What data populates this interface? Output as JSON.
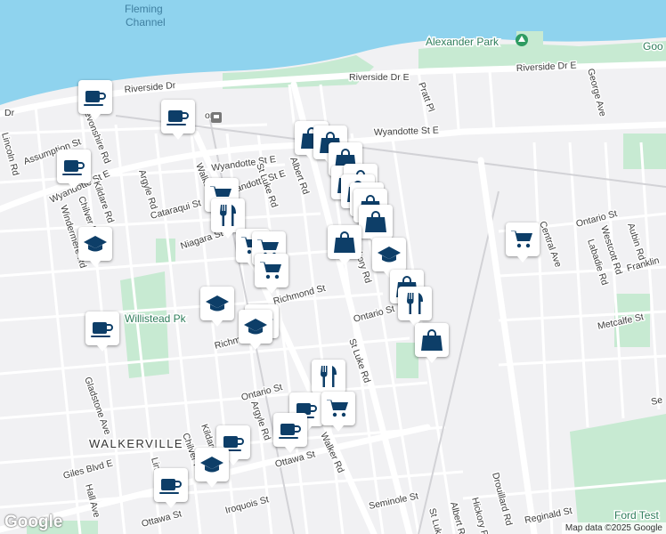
{
  "map": {
    "water_label": "Fleming\nChannel",
    "area_label": "WALKERVILLE",
    "attribution": "Map data ©2025 Google",
    "logo": "Google",
    "parks": [
      {
        "name": "Alexander Park"
      },
      {
        "name": "Willistead Pk"
      },
      {
        "name": "Ford Test"
      },
      {
        "name": "Goo"
      }
    ],
    "streets": [
      {
        "name": "Riverside Dr"
      },
      {
        "name": "Riverside Dr E"
      },
      {
        "name": "Riverside Dr E"
      },
      {
        "name": "Dr"
      },
      {
        "name": "Wyandotte St E"
      },
      {
        "name": "Wyandotte St E"
      },
      {
        "name": "Wyandotte St E"
      },
      {
        "name": "Assumption St"
      },
      {
        "name": "Devonshire Rd"
      },
      {
        "name": "Lincoln Rd"
      },
      {
        "name": "Kildare Rd"
      },
      {
        "name": "Chilver Rd"
      },
      {
        "name": "Windermere Rd"
      },
      {
        "name": "Argyle Rd"
      },
      {
        "name": "Cataraqui St"
      },
      {
        "name": "Walker Rd"
      },
      {
        "name": "Wyandotte St E"
      },
      {
        "name": "St Luke Rd"
      },
      {
        "name": "Albert Rd"
      },
      {
        "name": "Niagara St"
      },
      {
        "name": "Hickory Rd"
      },
      {
        "name": "Richmond St"
      },
      {
        "name": "Richmond St"
      },
      {
        "name": "Ontario St"
      },
      {
        "name": "St Luke Rd"
      },
      {
        "name": "Ontario St"
      },
      {
        "name": "Gladstone Ave"
      },
      {
        "name": "Argyle Rd"
      },
      {
        "name": "Chilver Rd"
      },
      {
        "name": "Kildare Rd"
      },
      {
        "name": "Ottawa St"
      },
      {
        "name": "Walker Rd"
      },
      {
        "name": "Giles Blvd E"
      },
      {
        "name": "Hall Ave"
      },
      {
        "name": "Lincoln Rd"
      },
      {
        "name": "Ottawa St"
      },
      {
        "name": "Iroquois St"
      },
      {
        "name": "Pratt Pl"
      },
      {
        "name": "George Ave"
      },
      {
        "name": "Central Ave"
      },
      {
        "name": "Ontario St"
      },
      {
        "name": "Westcott Rd"
      },
      {
        "name": "Aubin Rd"
      },
      {
        "name": "Labadie Rd"
      },
      {
        "name": "Franklin"
      },
      {
        "name": "Metcalfe St"
      },
      {
        "name": "Se"
      },
      {
        "name": "Seminole St"
      },
      {
        "name": "St Luke"
      },
      {
        "name": "Albert Rd"
      },
      {
        "name": "Hickory Rd"
      },
      {
        "name": "Drouillard Rd"
      },
      {
        "name": "Reginald St"
      },
      {
        "name": "or"
      }
    ],
    "markers": [
      {
        "icon": "cafe"
      },
      {
        "icon": "cafe"
      },
      {
        "icon": "cafe"
      },
      {
        "icon": "school"
      },
      {
        "icon": "cafe"
      },
      {
        "icon": "grocery"
      },
      {
        "icon": "restaurant"
      },
      {
        "icon": "grocery"
      },
      {
        "icon": "grocery"
      },
      {
        "icon": "grocery"
      },
      {
        "icon": "school"
      },
      {
        "icon": "school"
      },
      {
        "icon": "school"
      },
      {
        "icon": "shopping"
      },
      {
        "icon": "shopping"
      },
      {
        "icon": "shopping"
      },
      {
        "icon": "shopping"
      },
      {
        "icon": "shopping"
      },
      {
        "icon": "shopping"
      },
      {
        "icon": "shopping"
      },
      {
        "icon": "shopping"
      },
      {
        "icon": "shopping"
      },
      {
        "icon": "shopping"
      },
      {
        "icon": "school"
      },
      {
        "icon": "shopping"
      },
      {
        "icon": "restaurant"
      },
      {
        "icon": "shopping"
      },
      {
        "icon": "grocery"
      },
      {
        "icon": "restaurant"
      },
      {
        "icon": "cafe"
      },
      {
        "icon": "grocery"
      },
      {
        "icon": "cafe"
      },
      {
        "icon": "cafe"
      },
      {
        "icon": "school"
      },
      {
        "icon": "cafe"
      }
    ]
  },
  "colors": {
    "water": "#8fd3ee",
    "park": "#c7ead2",
    "road": "#ffffff",
    "land": "#f1f1f3",
    "marker_icon": "#0d3e68"
  }
}
